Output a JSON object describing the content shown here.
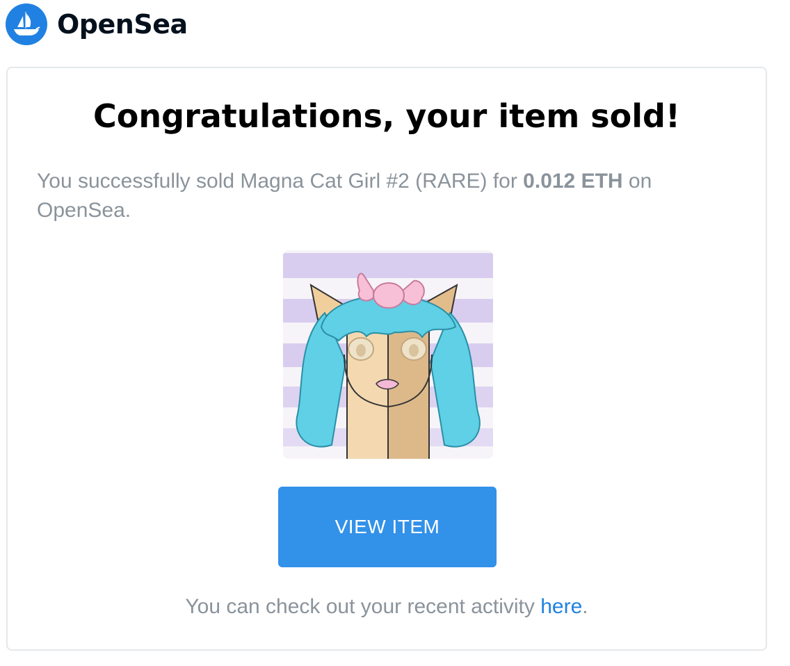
{
  "brand": {
    "name": "OpenSea",
    "logo_icon": "opensea-boat-icon",
    "color": "#2081e2"
  },
  "email": {
    "headline": "Congratulations, your item sold!",
    "message_prefix": "You successfully sold Magna Cat Girl #2 (RARE) for ",
    "price": "0.012 ETH",
    "message_suffix": " on OpenSea.",
    "button_label": "VIEW ITEM",
    "footer_prefix": "You can check out your recent activity ",
    "footer_link": "here",
    "footer_suffix": "."
  },
  "colors": {
    "button": "#3291e9",
    "muted_text": "#8a939b",
    "link": "#2081e2"
  }
}
